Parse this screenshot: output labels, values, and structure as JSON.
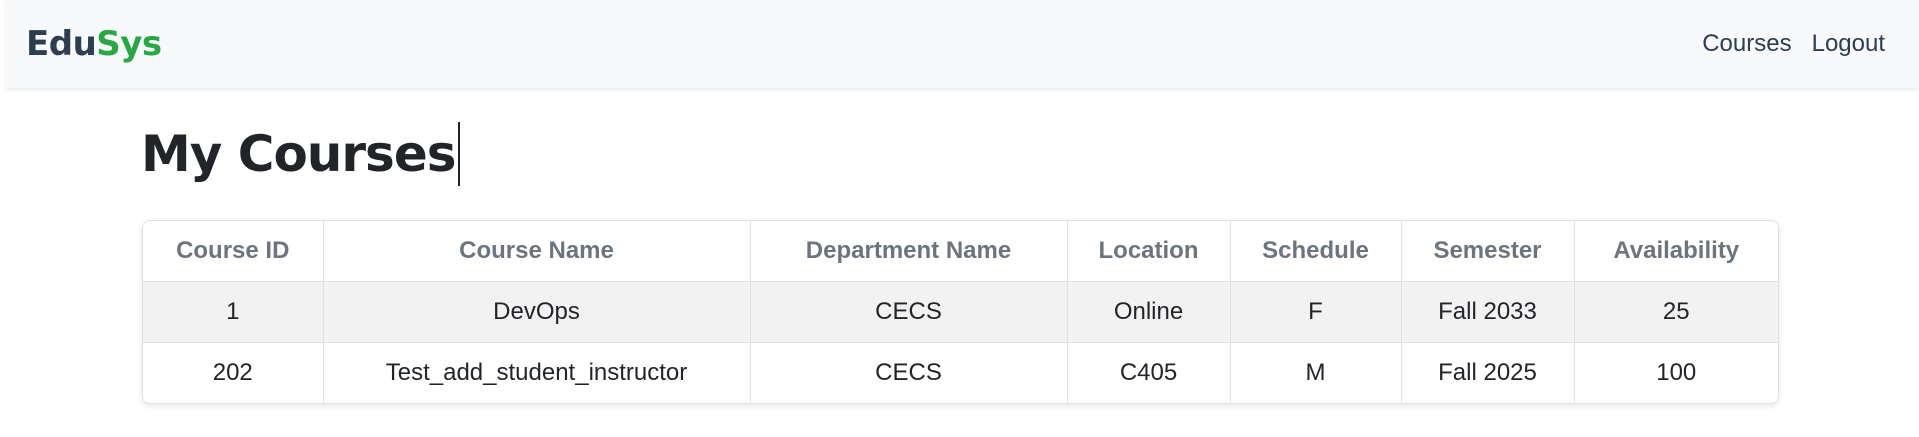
{
  "navbar": {
    "brand_part1": "Edu",
    "brand_part2": "Sys",
    "links": [
      "Courses",
      "Logout"
    ]
  },
  "page": {
    "title": "My Courses"
  },
  "table": {
    "headers": [
      "Course ID",
      "Course Name",
      "Department Name",
      "Location",
      "Schedule",
      "Semester",
      "Availability"
    ],
    "rows": [
      [
        "1",
        "DevOps",
        "CECS",
        "Online",
        "F",
        "Fall 2033",
        "25"
      ],
      [
        "202",
        "Test_add_student_instructor",
        "CECS",
        "C405",
        "M",
        "Fall 2025",
        "100"
      ]
    ]
  },
  "colors": {
    "brand_dark": "#2c3e50",
    "brand_green": "#28a745",
    "header_text": "#6c757d",
    "striped_row": "#f2f2f2"
  }
}
